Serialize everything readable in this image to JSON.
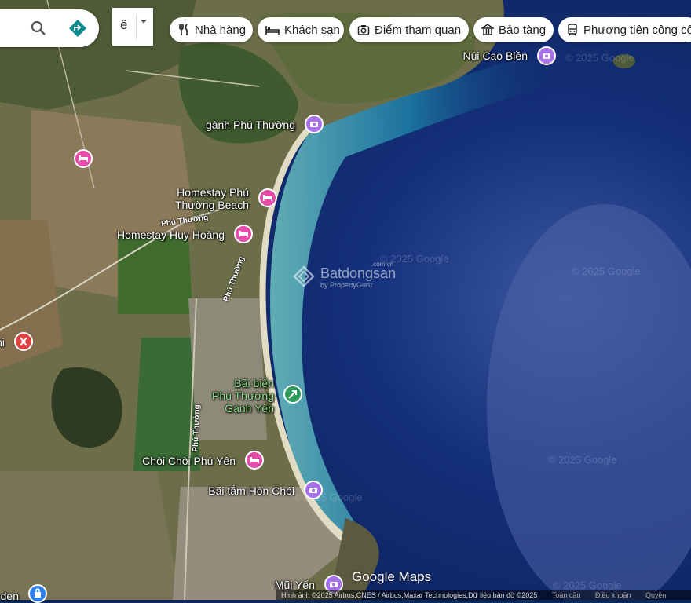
{
  "search": {
    "search_icon": "search-icon",
    "directions_icon": "directions-icon"
  },
  "lang": {
    "label": "ê"
  },
  "chips": [
    {
      "label": "Nhà hàng",
      "icon": "restaurant-icon"
    },
    {
      "label": "Khách sạn",
      "icon": "hotel-icon"
    },
    {
      "label": "Điểm tham quan",
      "icon": "camera-icon"
    },
    {
      "label": "Bảo tàng",
      "icon": "museum-icon"
    },
    {
      "label": "Phương tiện công cộ",
      "icon": "transit-icon"
    }
  ],
  "pois": [
    {
      "label": "Núi Cao Biền",
      "type": "attraction"
    },
    {
      "label": "gành Phú Thường",
      "type": "attraction"
    },
    {
      "label_line1": "Homestay Phú",
      "label_line2": "Thường Beach",
      "type": "hotel"
    },
    {
      "label": "Homestay Huy Hoàng",
      "type": "hotel"
    },
    {
      "label": "",
      "type": "hotel"
    },
    {
      "label": "hi",
      "type": "restaurant"
    },
    {
      "label_line1": "Bãi biển",
      "label_line2": "Phú Thường",
      "label_line3": "Gành Yến",
      "type": "park"
    },
    {
      "label": "Chòi Chòi Phú Yên",
      "type": "hotel"
    },
    {
      "label": "Bãi tắm Hòn Chói",
      "type": "attraction"
    },
    {
      "label": "Mũi Yến",
      "type": "attraction"
    },
    {
      "label": "arden",
      "type": "shopping"
    }
  ],
  "streets": {
    "s1": "Phú Thường",
    "s2": "Phú Thường",
    "s3": "Phú Thường"
  },
  "watermark": {
    "brand": "Batdongsan",
    "domain": ".com.vn",
    "by": "by PropertyGuru",
    "copy": "© 2025 Google"
  },
  "footer": {
    "logo": "Google Maps",
    "attribution": "Hình ảnh ©2025 Airbus,CNES / Airbus,Maxar Technologies,Dữ liệu bản đồ ©2025",
    "link1": "Toàn cầu",
    "link2": "Điều khoản",
    "link3": "Quyền"
  },
  "colors": {
    "attraction": "#a770e8",
    "hotel": "#e34ca8",
    "restaurant": "#e04242",
    "park": "#2e9b5c",
    "shopping": "#2f7ff0"
  }
}
